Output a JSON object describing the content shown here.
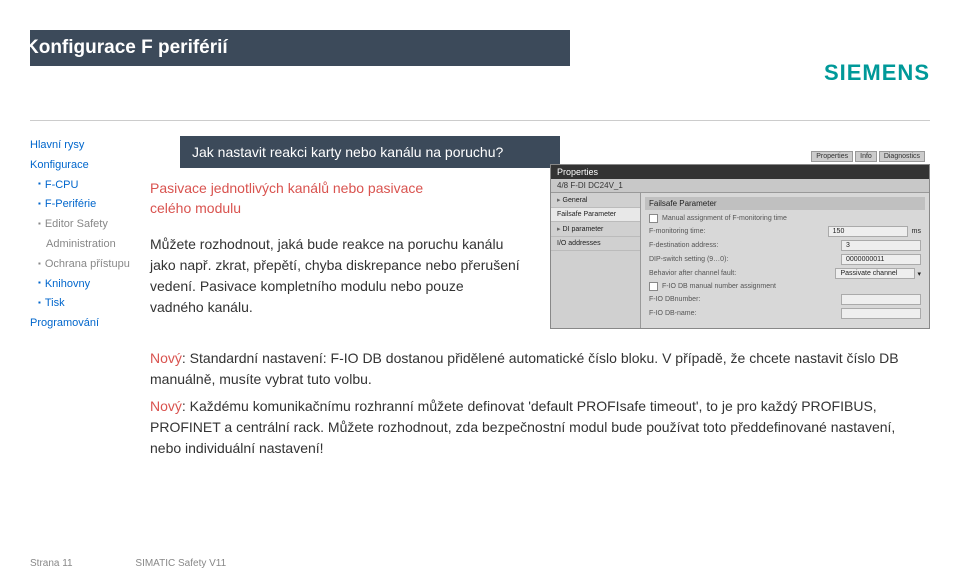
{
  "header": {
    "title": "Konfigurace F periférií",
    "logo": "SIEMENS"
  },
  "sidebar": {
    "items": [
      {
        "label": "Hlavní rysy",
        "cls": "blue"
      },
      {
        "label": "Konfigurace",
        "cls": "blue"
      },
      {
        "label": "F-CPU",
        "cls": "blue sub bullet"
      },
      {
        "label": "F-Periférie",
        "cls": "blue sub bullet"
      },
      {
        "label": "Editor Safety",
        "cls": "sub bullet"
      },
      {
        "label": "Administration",
        "cls": "sub",
        "indent": true
      },
      {
        "label": "Ochrana přístupu",
        "cls": "sub bullet"
      },
      {
        "label": "Knihovny",
        "cls": "blue sub bullet"
      },
      {
        "label": "Tisk",
        "cls": "blue sub bullet"
      },
      {
        "label": "Programování",
        "cls": "blue"
      }
    ]
  },
  "main": {
    "question": "Jak nastavit reakci karty nebo kanálu na poruchu?",
    "subtitle_line1": "Pasivace jednotlivých kanálů nebo pasivace",
    "subtitle_line2": "celého modulu",
    "body_p1": "Můžete rozhodnout, jaká bude reakce na poruchu kanálu jako např. zkrat, přepětí, chyba diskrepance nebo přerušení vedení. Pasivace kompletního modulu nebo pouze vadného kanálu.",
    "lower": [
      {
        "red": "Nový",
        "rest": ": Standardní nastavení: F-IO DB dostanou přidělené automatické číslo bloku. V případě, že chcete nastavit číslo DB manuálně, musíte vybrat tuto volbu."
      },
      {
        "red": "Nový",
        "rest": ": Každému komunikačnímu rozhranní můžete definovat 'default PROFIsafe timeout', to je pro každý PROFIBUS, PROFINET a centrální rack. Můžete rozhodnout, zda bezpečnostní modul bude používat toto předdefinované nastavení, nebo individuální nastavení!"
      }
    ]
  },
  "panel": {
    "title": "Properties",
    "address": "4/8 F-DI DC24V_1",
    "tabs": [
      "Properties",
      "Info",
      "Diagnostics"
    ],
    "left_items": [
      "General",
      "Failsafe Parameter",
      "DI parameter",
      "I/O addresses"
    ],
    "section_header": "Failsafe Parameter",
    "rows": [
      {
        "type": "check",
        "label": "Manual assignment of F-monitoring time"
      },
      {
        "type": "input",
        "label": "F-monitoring time:",
        "value": "150",
        "unit": "ms"
      },
      {
        "type": "input",
        "label": "F-destination address:",
        "value": "3"
      },
      {
        "type": "input",
        "label": "DIP-switch setting (9…0):",
        "value": "0000000011"
      },
      {
        "type": "input",
        "label": "Behavior after channel fault:",
        "value": "Passivate channel"
      },
      {
        "type": "check",
        "label": "F-IO DB manual number assignment"
      },
      {
        "type": "input",
        "label": "F-IO DBnumber:",
        "value": ""
      },
      {
        "type": "input",
        "label": "F-IO DB-name:",
        "value": ""
      }
    ]
  },
  "footer": {
    "page": "Strana 11",
    "product": "SIMATIC Safety V11"
  }
}
